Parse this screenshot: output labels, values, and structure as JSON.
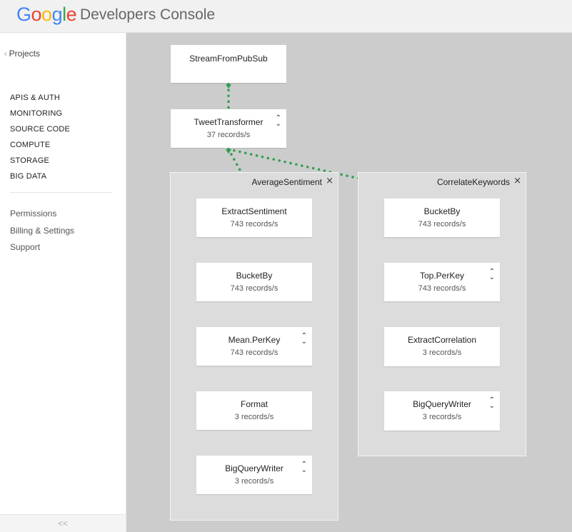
{
  "header": {
    "logo_letters": [
      {
        "ch": "G",
        "color": "#4285F4"
      },
      {
        "ch": "o",
        "color": "#EA4335"
      },
      {
        "ch": "o",
        "color": "#FBBC05"
      },
      {
        "ch": "g",
        "color": "#4285F4"
      },
      {
        "ch": "l",
        "color": "#34A853"
      },
      {
        "ch": "e",
        "color": "#EA4335"
      }
    ],
    "product": "Developers Console"
  },
  "sidebar": {
    "projects": "Projects",
    "primary": [
      "APIS & AUTH",
      "MONITORING",
      "SOURCE CODE",
      "COMPUTE",
      "STORAGE",
      "BIG DATA"
    ],
    "secondary": [
      "Permissions",
      "Billing & Settings",
      "Support"
    ],
    "collapse": "<<"
  },
  "colors": {
    "edge": "#2e9e4f",
    "canvas": "#cccccc",
    "group_bg": "#dcdcdc"
  },
  "pipeline": {
    "top_nodes": [
      {
        "name": "StreamFromPubSub",
        "rate": "",
        "expandable": false
      },
      {
        "name": "TweetTransformer",
        "rate": "37 records/s",
        "expandable": true
      }
    ],
    "groups": [
      {
        "title": "AverageSentiment",
        "nodes": [
          {
            "name": "ExtractSentiment",
            "rate": "743 records/s",
            "expandable": false
          },
          {
            "name": "BucketBy",
            "rate": "743 records/s",
            "expandable": false
          },
          {
            "name": "Mean.PerKey",
            "rate": "743 records/s",
            "expandable": true
          },
          {
            "name": "Format",
            "rate": "3 records/s",
            "expandable": false
          },
          {
            "name": "BigQueryWriter",
            "rate": "3 records/s",
            "expandable": true
          }
        ]
      },
      {
        "title": "CorrelateKeywords",
        "nodes": [
          {
            "name": "BucketBy",
            "rate": "743 records/s",
            "expandable": false
          },
          {
            "name": "Top.PerKey",
            "rate": "743 records/s",
            "expandable": true
          },
          {
            "name": "ExtractCorrelation",
            "rate": "3 records/s",
            "expandable": false
          },
          {
            "name": "BigQueryWriter",
            "rate": "3 records/s",
            "expandable": true
          }
        ]
      }
    ]
  }
}
